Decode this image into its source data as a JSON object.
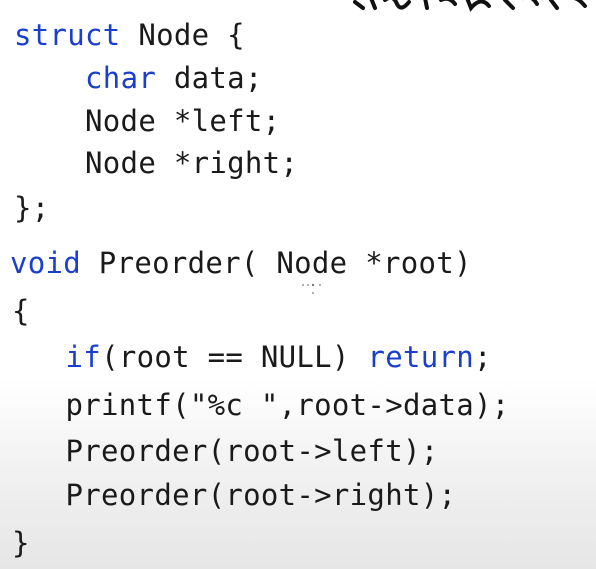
{
  "code": {
    "line1": {
      "kw": "struct",
      "rest": " Node {"
    },
    "line2": {
      "indent": "    ",
      "kw": "char",
      "rest": " data;"
    },
    "line3": {
      "text": "    Node *left;"
    },
    "line4": {
      "text": "    Node *right;"
    },
    "line5": {
      "text": "};"
    },
    "line6": {
      "kw": "void",
      "rest": " Preorder( Node *root)"
    },
    "line7": {
      "text": "{"
    },
    "line8": {
      "indent": "  ",
      "kw1": "if",
      "mid": "(root == NULL) ",
      "kw2": "return",
      "end": ";"
    },
    "line9": {
      "text": "  printf(\"%c \",root->data);"
    },
    "line10": {
      "text": "  Preorder(root->left);"
    },
    "line11": {
      "text": "  Preorder(root->right);"
    },
    "line12": {
      "text": "}"
    }
  },
  "colors": {
    "keyword": "#1a3fcf",
    "text": "#1a1a1a",
    "background": "#ffffff"
  }
}
